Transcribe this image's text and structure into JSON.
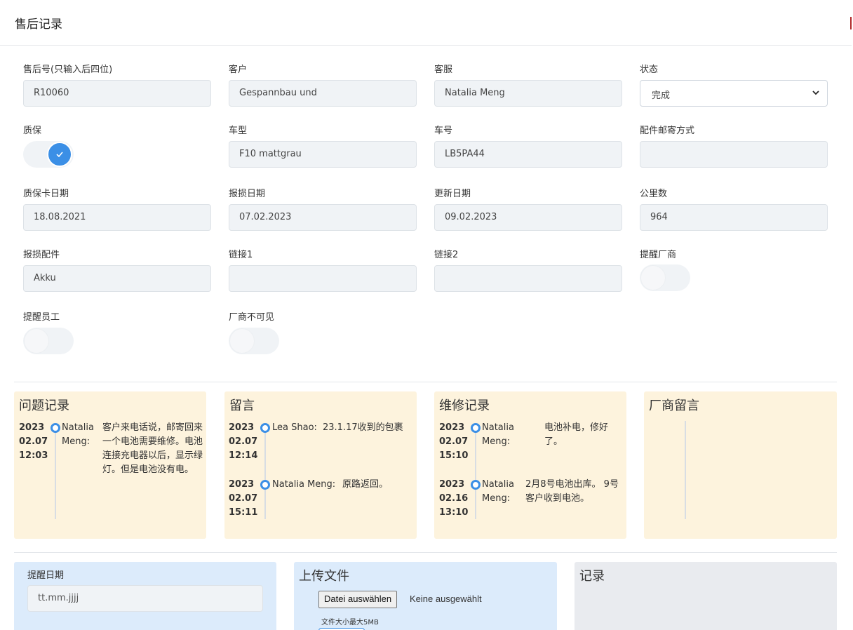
{
  "title": "售后记录",
  "fields": {
    "rma_no": {
      "label": "售后号(只输入后四位)",
      "value": "R10060"
    },
    "customer": {
      "label": "客户",
      "value": "Gespannbau und"
    },
    "agent": {
      "label": "客服",
      "value": "Natalia Meng"
    },
    "status": {
      "label": "状态",
      "value": "完成"
    },
    "warranty": {
      "label": "质保",
      "on": true
    },
    "model": {
      "label": "车型",
      "value": "F10 mattgrau"
    },
    "vehicle_no": {
      "label": "车号",
      "value": "LB5PA44"
    },
    "shipping": {
      "label": "配件邮寄方式",
      "value": ""
    },
    "warranty_date": {
      "label": "质保卡日期",
      "value": "18.08.2021"
    },
    "damage_date": {
      "label": "报损日期",
      "value": "07.02.2023"
    },
    "update_date": {
      "label": "更新日期",
      "value": "09.02.2023"
    },
    "mileage": {
      "label": "公里数",
      "value": "964"
    },
    "damaged_part": {
      "label": "报损配件",
      "value": "Akku"
    },
    "link1": {
      "label": "链接1",
      "value": ""
    },
    "link2": {
      "label": "链接2",
      "value": ""
    },
    "remind_vendor": {
      "label": "提醒厂商",
      "on": false
    },
    "remind_staff": {
      "label": "提醒员工",
      "on": false
    },
    "vendor_hidden": {
      "label": "厂商不可见",
      "on": false
    }
  },
  "panels": {
    "problems": {
      "title": "问题记录",
      "entries": [
        {
          "y": "2023",
          "md": "02.07",
          "t": "12:03",
          "author": "Natalia Meng:",
          "msg": "客户来电话说，邮寄回来一个电池需要维修。电池连接充电器以后，显示绿灯。但是电池没有电。"
        }
      ]
    },
    "comments": {
      "title": "留言",
      "entries": [
        {
          "y": "2023",
          "md": "02.07",
          "t": "12:14",
          "author": "Lea Shao:",
          "msg": "23.1.17收到的包裹"
        },
        {
          "y": "2023",
          "md": "02.07",
          "t": "15:11",
          "author": "Natalia Meng:",
          "msg": "原路返回。"
        }
      ]
    },
    "repairs": {
      "title": "维修记录",
      "entries": [
        {
          "y": "2023",
          "md": "02.07",
          "t": "15:10",
          "author": "Natalia Meng:",
          "msg": "电池补电，修好了。"
        },
        {
          "y": "2023",
          "md": "02.16",
          "t": "13:10",
          "author": "Natalia Meng:",
          "msg": "2月8号电池出库。 9号客户收到电池。"
        }
      ]
    },
    "vendor": {
      "title": "厂商留言"
    }
  },
  "bottom": {
    "remind_date": {
      "label": "提醒日期",
      "placeholder": "tt.mm.jjjj"
    },
    "upload": {
      "title": "上传文件",
      "button": "Datei auswählen",
      "none": "Keine ausgewählt",
      "hint": "文件大小最大5MB"
    },
    "log": {
      "title": "记录"
    }
  },
  "colors": {
    "accent": "#3b8fe6",
    "panel_bg": "#fdf3dd",
    "blue_panel": "#dcebfb",
    "gray_panel": "#e9ebef"
  }
}
